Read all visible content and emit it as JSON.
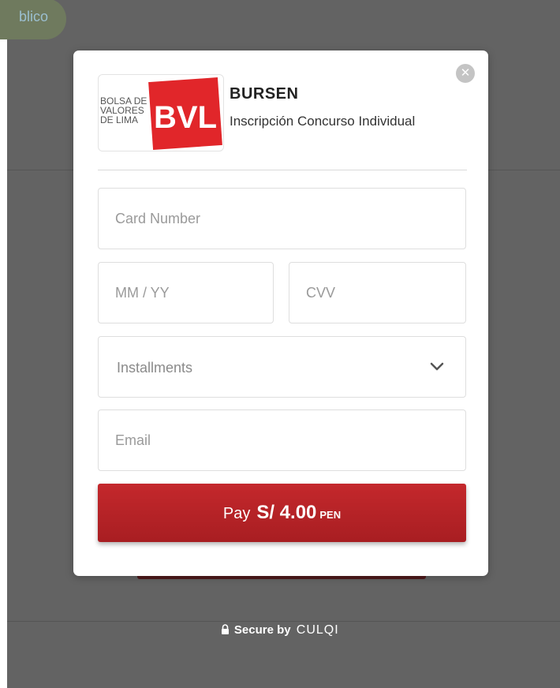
{
  "background": {
    "pill_text": "blico",
    "secure": {
      "lock_icon": "lock-icon",
      "label": "Secure by",
      "brand": "CULQI"
    }
  },
  "modal": {
    "close_icon": "close-icon",
    "logo": {
      "line1": "BOLSA DE",
      "line2": "VALORES",
      "line3": "DE LIMA",
      "mark": "BVL"
    },
    "merchant_name": "BURSEN",
    "merchant_desc": "Inscripción Concurso Individual",
    "card_number": {
      "placeholder": "Card Number",
      "value": ""
    },
    "expiry": {
      "placeholder": "MM / YY",
      "value": ""
    },
    "cvv": {
      "placeholder": "CVV",
      "value": ""
    },
    "installments": {
      "label": "Installments",
      "icon": "chevron-down-icon"
    },
    "email": {
      "placeholder": "Email",
      "value": ""
    },
    "pay": {
      "label": "Pay",
      "amount": "S/ 4.00",
      "currency": "PEN"
    }
  },
  "colors": {
    "overlay": "#636363",
    "accent": "#b52327",
    "logo_red": "#e1262a"
  }
}
